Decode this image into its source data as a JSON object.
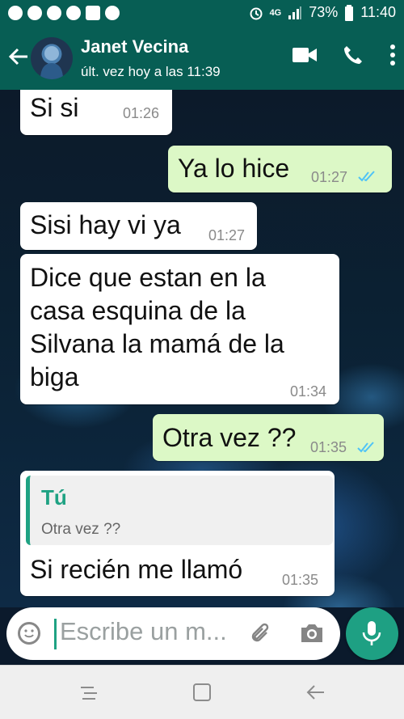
{
  "status_bar": {
    "battery": "73%",
    "time": "11:40",
    "network": "4G"
  },
  "header": {
    "contact_name": "Janet Vecina",
    "last_seen": "últ. vez hoy a las 11:39"
  },
  "messages": [
    {
      "text": "Si si",
      "time": "01:26"
    },
    {
      "text": "Ya lo hice",
      "time": "01:27"
    },
    {
      "text": "Sisi hay vi ya",
      "time": "01:27"
    },
    {
      "lines": [
        "Dice que estan en la",
        "casa esquina de la",
        "Silvana la mamá de la",
        "biga"
      ],
      "time": "01:34"
    },
    {
      "text": "Otra vez ??",
      "time": "01:35"
    },
    {
      "quote_author": "Tú",
      "quote_text": "Otra vez ??",
      "text": "Si recién me llamó",
      "time": "01:35"
    }
  ],
  "composer": {
    "placeholder": "Escribe un m..."
  },
  "colors": {
    "header": "#075e54",
    "accent": "#1ea083",
    "outgoing_bubble": "#dcf8c6",
    "incoming_bubble": "#ffffff",
    "read_ticks": "#4fc3f7"
  },
  "icons": [
    "back-arrow-icon",
    "video-call-icon",
    "phone-icon",
    "more-options-icon",
    "emoji-icon",
    "attach-icon",
    "camera-icon",
    "mic-icon",
    "read-receipt-icon",
    "nav-recent-icon",
    "nav-home-icon",
    "nav-back-icon"
  ]
}
